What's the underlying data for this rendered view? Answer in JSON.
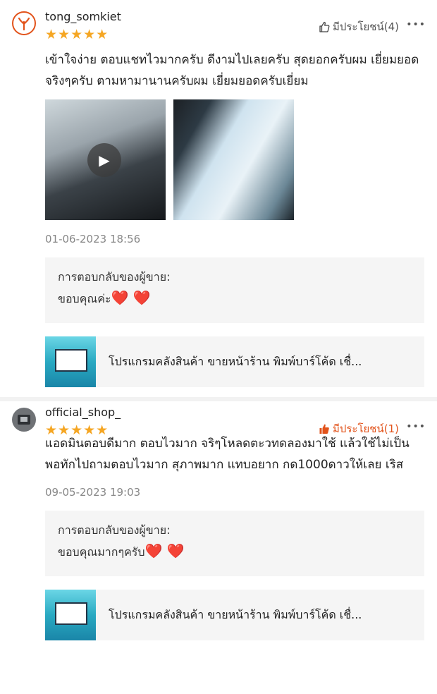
{
  "reviews": [
    {
      "username": "tong_somkiet",
      "stars": "★★★★★",
      "helpful_label": "มีประโยชน์(4)",
      "more_icon": "•••",
      "text": "เข้าใจง่าย ตอบแชทไวมากครับ ดีงามไปเลยครับ สุดยอกครับผม เยี่ยมยอดจริงๆครับ ตามหามานานครับผม เยี่ยมยอดครับเยี่ยม",
      "date": "01-06-2023 18:56",
      "reply_title": "การตอบกลับของผู้ขาย:",
      "reply_text": "ขอบคุณค่ะ",
      "reply_hearts": "❤️ ❤️",
      "product_name": "โปรแกรมคลังสินค้า ขายหน้าร้าน พิมพ์บาร์โค้ด เชื่..."
    },
    {
      "username": "official_shop_",
      "stars": "★★★★★",
      "helpful_label": "มีประโยชน์(1)",
      "more_icon": "•••",
      "text": "แอดมินตอบดีมาก ตอบไวมาก จริๆโหลดตะวทดลองมาใช้ แล้วใช้ไม่เป็น พอทักไปถามตอบไวมาก สุภาพมาก แทบอยาก กด1000ดาวให้เลย เริส",
      "date": "09-05-2023 19:03",
      "reply_title": "การตอบกลับของผู้ขาย:",
      "reply_text": "ขอบคุณมากๆครับ",
      "reply_hearts": "❤️ ❤️",
      "product_name": "โปรแกรมคลังสินค้า ขายหน้าร้าน พิมพ์บาร์โค้ด เชื่..."
    }
  ],
  "icons": {
    "thumbs_up_outline": "thumbs-up-outline-icon",
    "thumbs_up_filled": "thumbs-up-filled-icon",
    "play": "play-icon"
  },
  "colors": {
    "star": "#f5a623",
    "accent": "#e2531b",
    "reply_bg": "#f5f5f5"
  }
}
